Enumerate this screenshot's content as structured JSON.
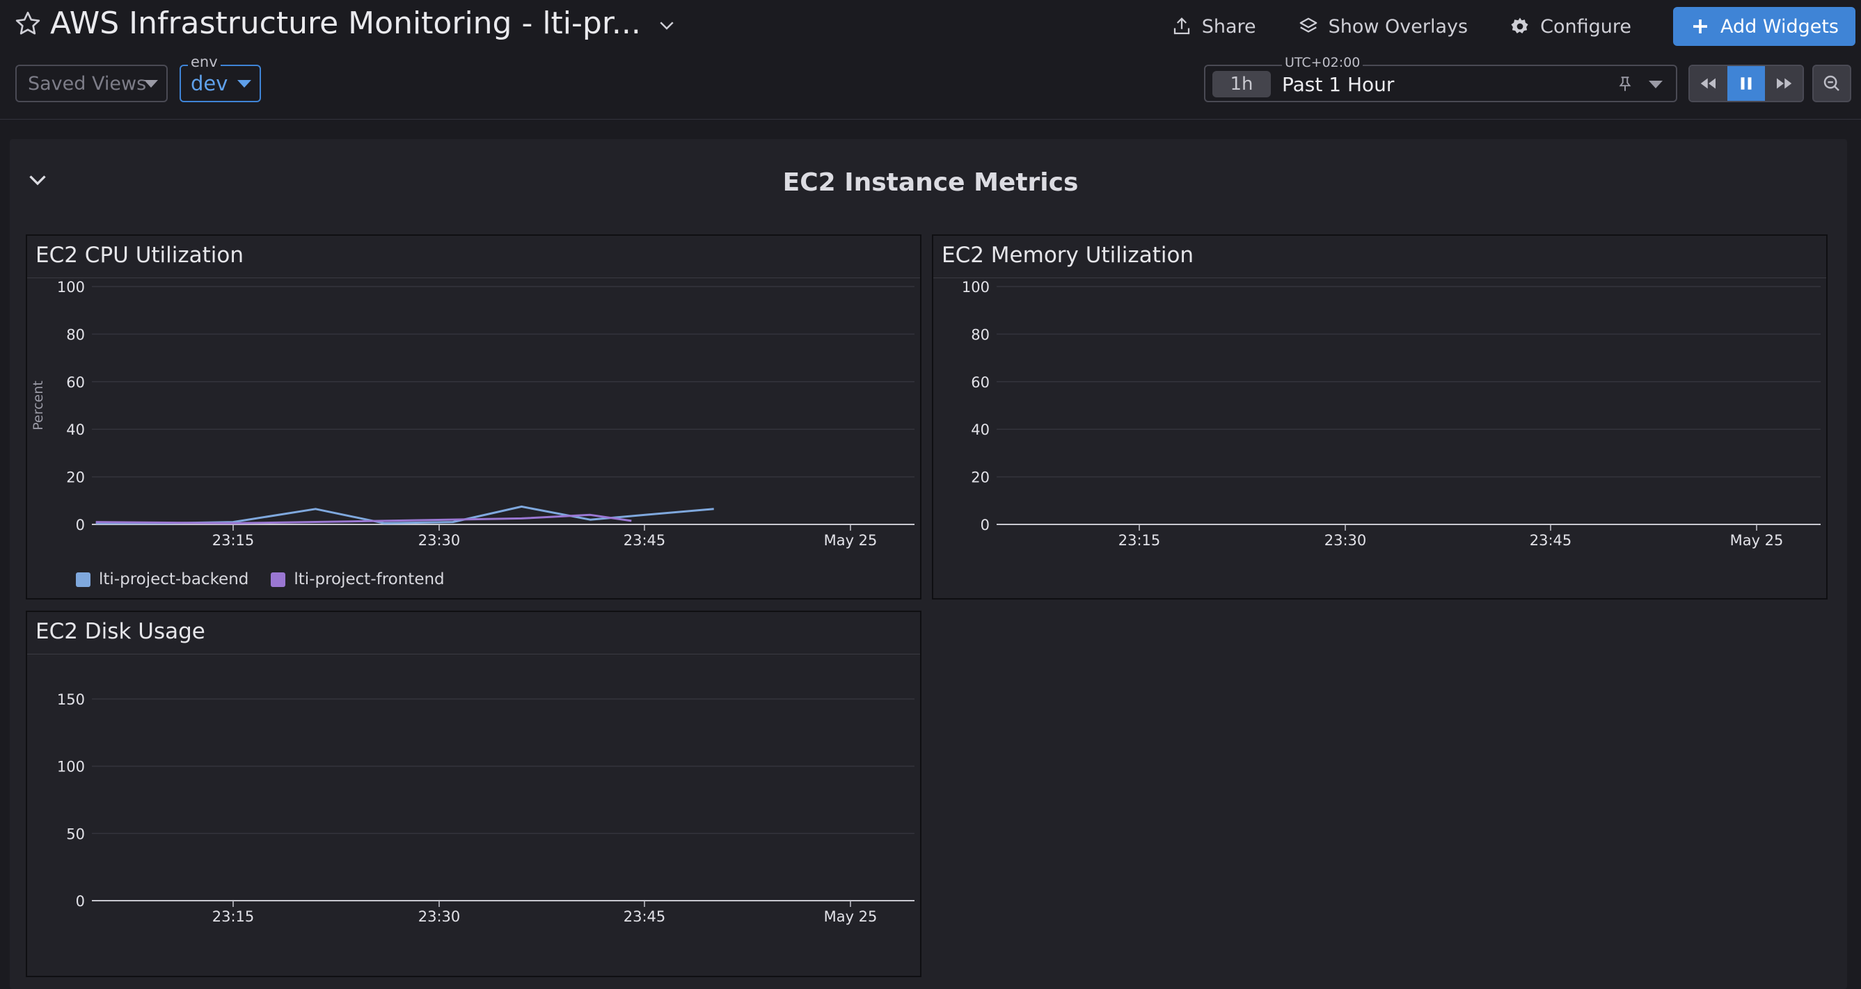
{
  "header": {
    "title": "AWS Infrastructure Monitoring - lti-pr...",
    "actions": {
      "share": "Share",
      "overlays": "Show Overlays",
      "configure": "Configure",
      "add_widgets": "Add Widgets"
    },
    "saved_views": {
      "placeholder": "Saved Views"
    },
    "env_selector": {
      "label": "env",
      "value": "dev"
    },
    "time_picker": {
      "timezone": "UTC+02:00",
      "pill": "1h",
      "value": "Past 1 Hour"
    }
  },
  "section": {
    "title": "EC2 Instance Metrics"
  },
  "colors": {
    "accent": "#3f84d6",
    "backend": "#7fa8dd",
    "frontend": "#9a77d2"
  },
  "widgets": {
    "cpu": {
      "title": "EC2 CPU Utilization"
    },
    "memory": {
      "title": "EC2 Memory Utilization"
    },
    "disk": {
      "title": "EC2 Disk Usage"
    }
  },
  "chart_data": [
    {
      "type": "line",
      "title": "EC2 CPU Utilization",
      "ylabel": "Percent",
      "ylim": [
        0,
        100
      ],
      "yticks": [
        "100",
        "80",
        "60",
        "40",
        "20",
        "0"
      ],
      "xticks": [
        "23:15",
        "23:30",
        "23:45",
        "May 25"
      ],
      "legend": [
        "lti-project-backend",
        "lti-project-frontend"
      ],
      "series": [
        {
          "name": "lti-project-backend",
          "x": [
            "23:05",
            "23:10",
            "23:15",
            "23:21",
            "23:26",
            "23:31",
            "23:36",
            "23:41",
            "23:45",
            "23:50"
          ],
          "values": [
            0.5,
            0.5,
            1,
            6.5,
            0.5,
            1,
            7.5,
            2,
            4,
            6.5
          ]
        },
        {
          "name": "lti-project-frontend",
          "x": [
            "23:05",
            "23:15",
            "23:26",
            "23:36",
            "23:41",
            "23:44"
          ],
          "values": [
            1,
            0.5,
            1.5,
            2.5,
            4,
            1.5
          ]
        }
      ]
    },
    {
      "type": "line",
      "title": "EC2 Memory Utilization",
      "ylim": [
        0,
        100
      ],
      "yticks": [
        "100",
        "80",
        "60",
        "40",
        "20",
        "0"
      ],
      "xticks": [
        "23:15",
        "23:30",
        "23:45",
        "May 25"
      ],
      "series": []
    },
    {
      "type": "line",
      "title": "EC2 Disk Usage",
      "ylim": [
        0,
        150
      ],
      "yticks": [
        "150",
        "100",
        "50",
        "0"
      ],
      "xticks": [
        "23:15",
        "23:30",
        "23:45",
        "May 25"
      ],
      "series": []
    }
  ]
}
